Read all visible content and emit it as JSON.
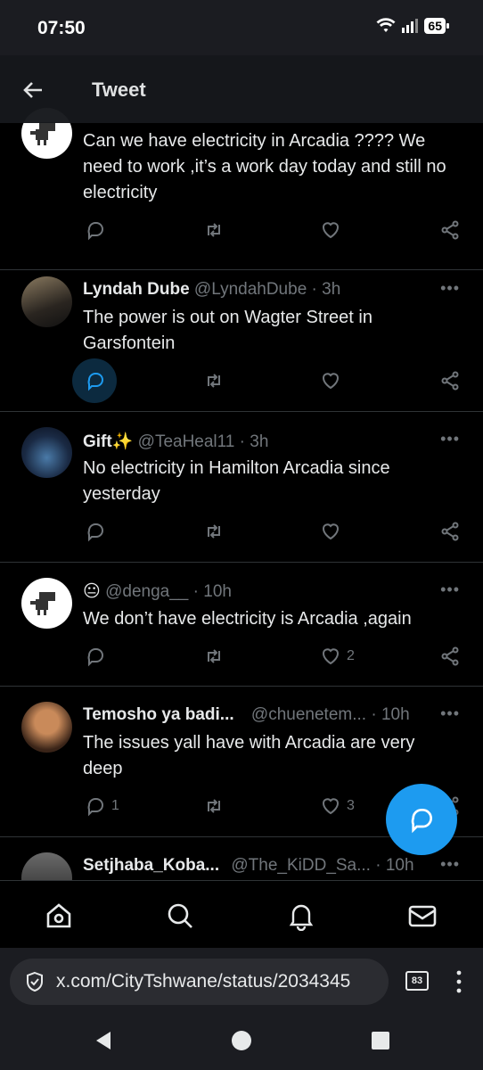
{
  "status_bar": {
    "time": "07:50",
    "battery": "65"
  },
  "header": {
    "title": "Tweet"
  },
  "tweets": [
    {
      "name": "",
      "handle": "",
      "time": "",
      "text": "Can we have electricity in Arcadia ???? We need to work ,it’s a work day today and still no electricity",
      "replies": "",
      "likes": ""
    },
    {
      "name": "Lyndah Dube",
      "handle": "@LyndahDube",
      "time": "· 3h",
      "text": "The power is out on Wagter Street in Garsfontein",
      "replies": "",
      "likes": ""
    },
    {
      "name": "Gift✨",
      "handle": "@TeaHeal11",
      "time": "· 3h",
      "text": "No electricity in Hamilton Arcadia since yesterday",
      "replies": "",
      "likes": ""
    },
    {
      "name": "😐",
      "handle": "@denga__",
      "time": "· 10h",
      "text": "We don’t have electricity is Arcadia ,again",
      "replies": "",
      "likes": "2"
    },
    {
      "name": "Temosho ya badi...",
      "handle": "@chuenetem...",
      "time": "· 10h",
      "text": "The issues yall have with Arcadia are very deep",
      "replies": "1",
      "likes": "3"
    },
    {
      "name": "Setjhaba_Koba...",
      "handle": "@The_KiDD_Sa...",
      "time": "· 10h",
      "text": "",
      "replies": "",
      "likes": ""
    }
  ],
  "browser": {
    "url": "x.com/CityTshwane/status/2034345",
    "tabs": "83"
  },
  "colors": {
    "accent": "#1d9bf0",
    "background": "#000000",
    "secondary_text": "#71767b"
  }
}
